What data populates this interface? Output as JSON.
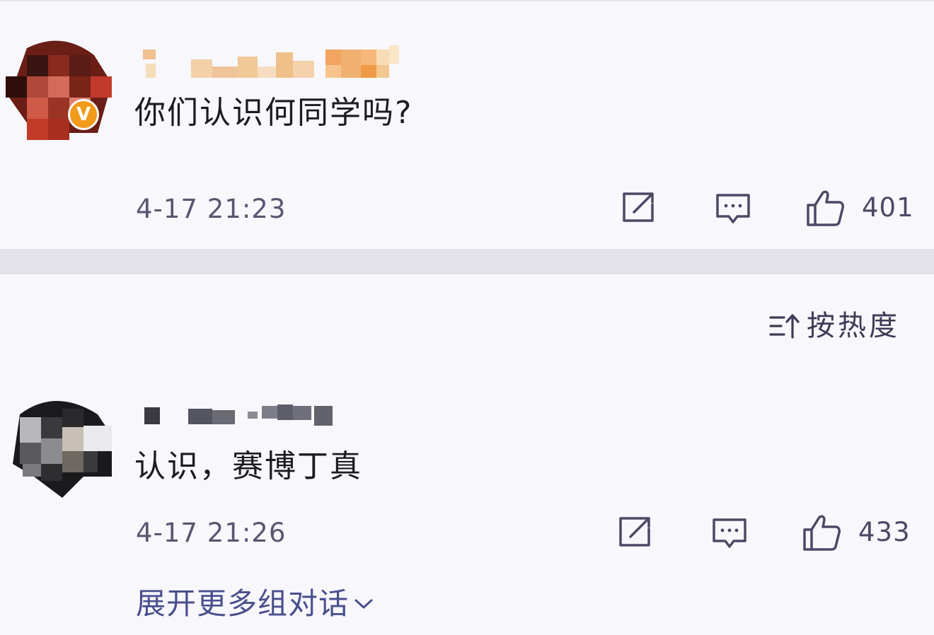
{
  "comments": [
    {
      "text": "你们认识何同学吗?",
      "timestamp": "4-17 21:23",
      "likes": "401",
      "verified_badge": "V",
      "icons": {
        "repost": "repost-icon",
        "reply": "comment-icon",
        "like": "thumbs-up-icon"
      }
    },
    {
      "text": "认识，赛博丁真",
      "timestamp": "4-17 21:26",
      "likes": "433",
      "icons": {
        "repost": "repost-icon",
        "reply": "comment-icon",
        "like": "thumbs-up-icon"
      }
    }
  ],
  "sort": {
    "label": "按热度",
    "icon": "sort-icon"
  },
  "expand": {
    "label": "展开更多组对话",
    "icon": "chevron-down-icon"
  },
  "colors": {
    "background": "#f7f7fc",
    "divider": "#e2e2e8",
    "meta_text": "#5b5570",
    "link": "#4a4f8c",
    "verified_badge": "#f29a1a"
  }
}
